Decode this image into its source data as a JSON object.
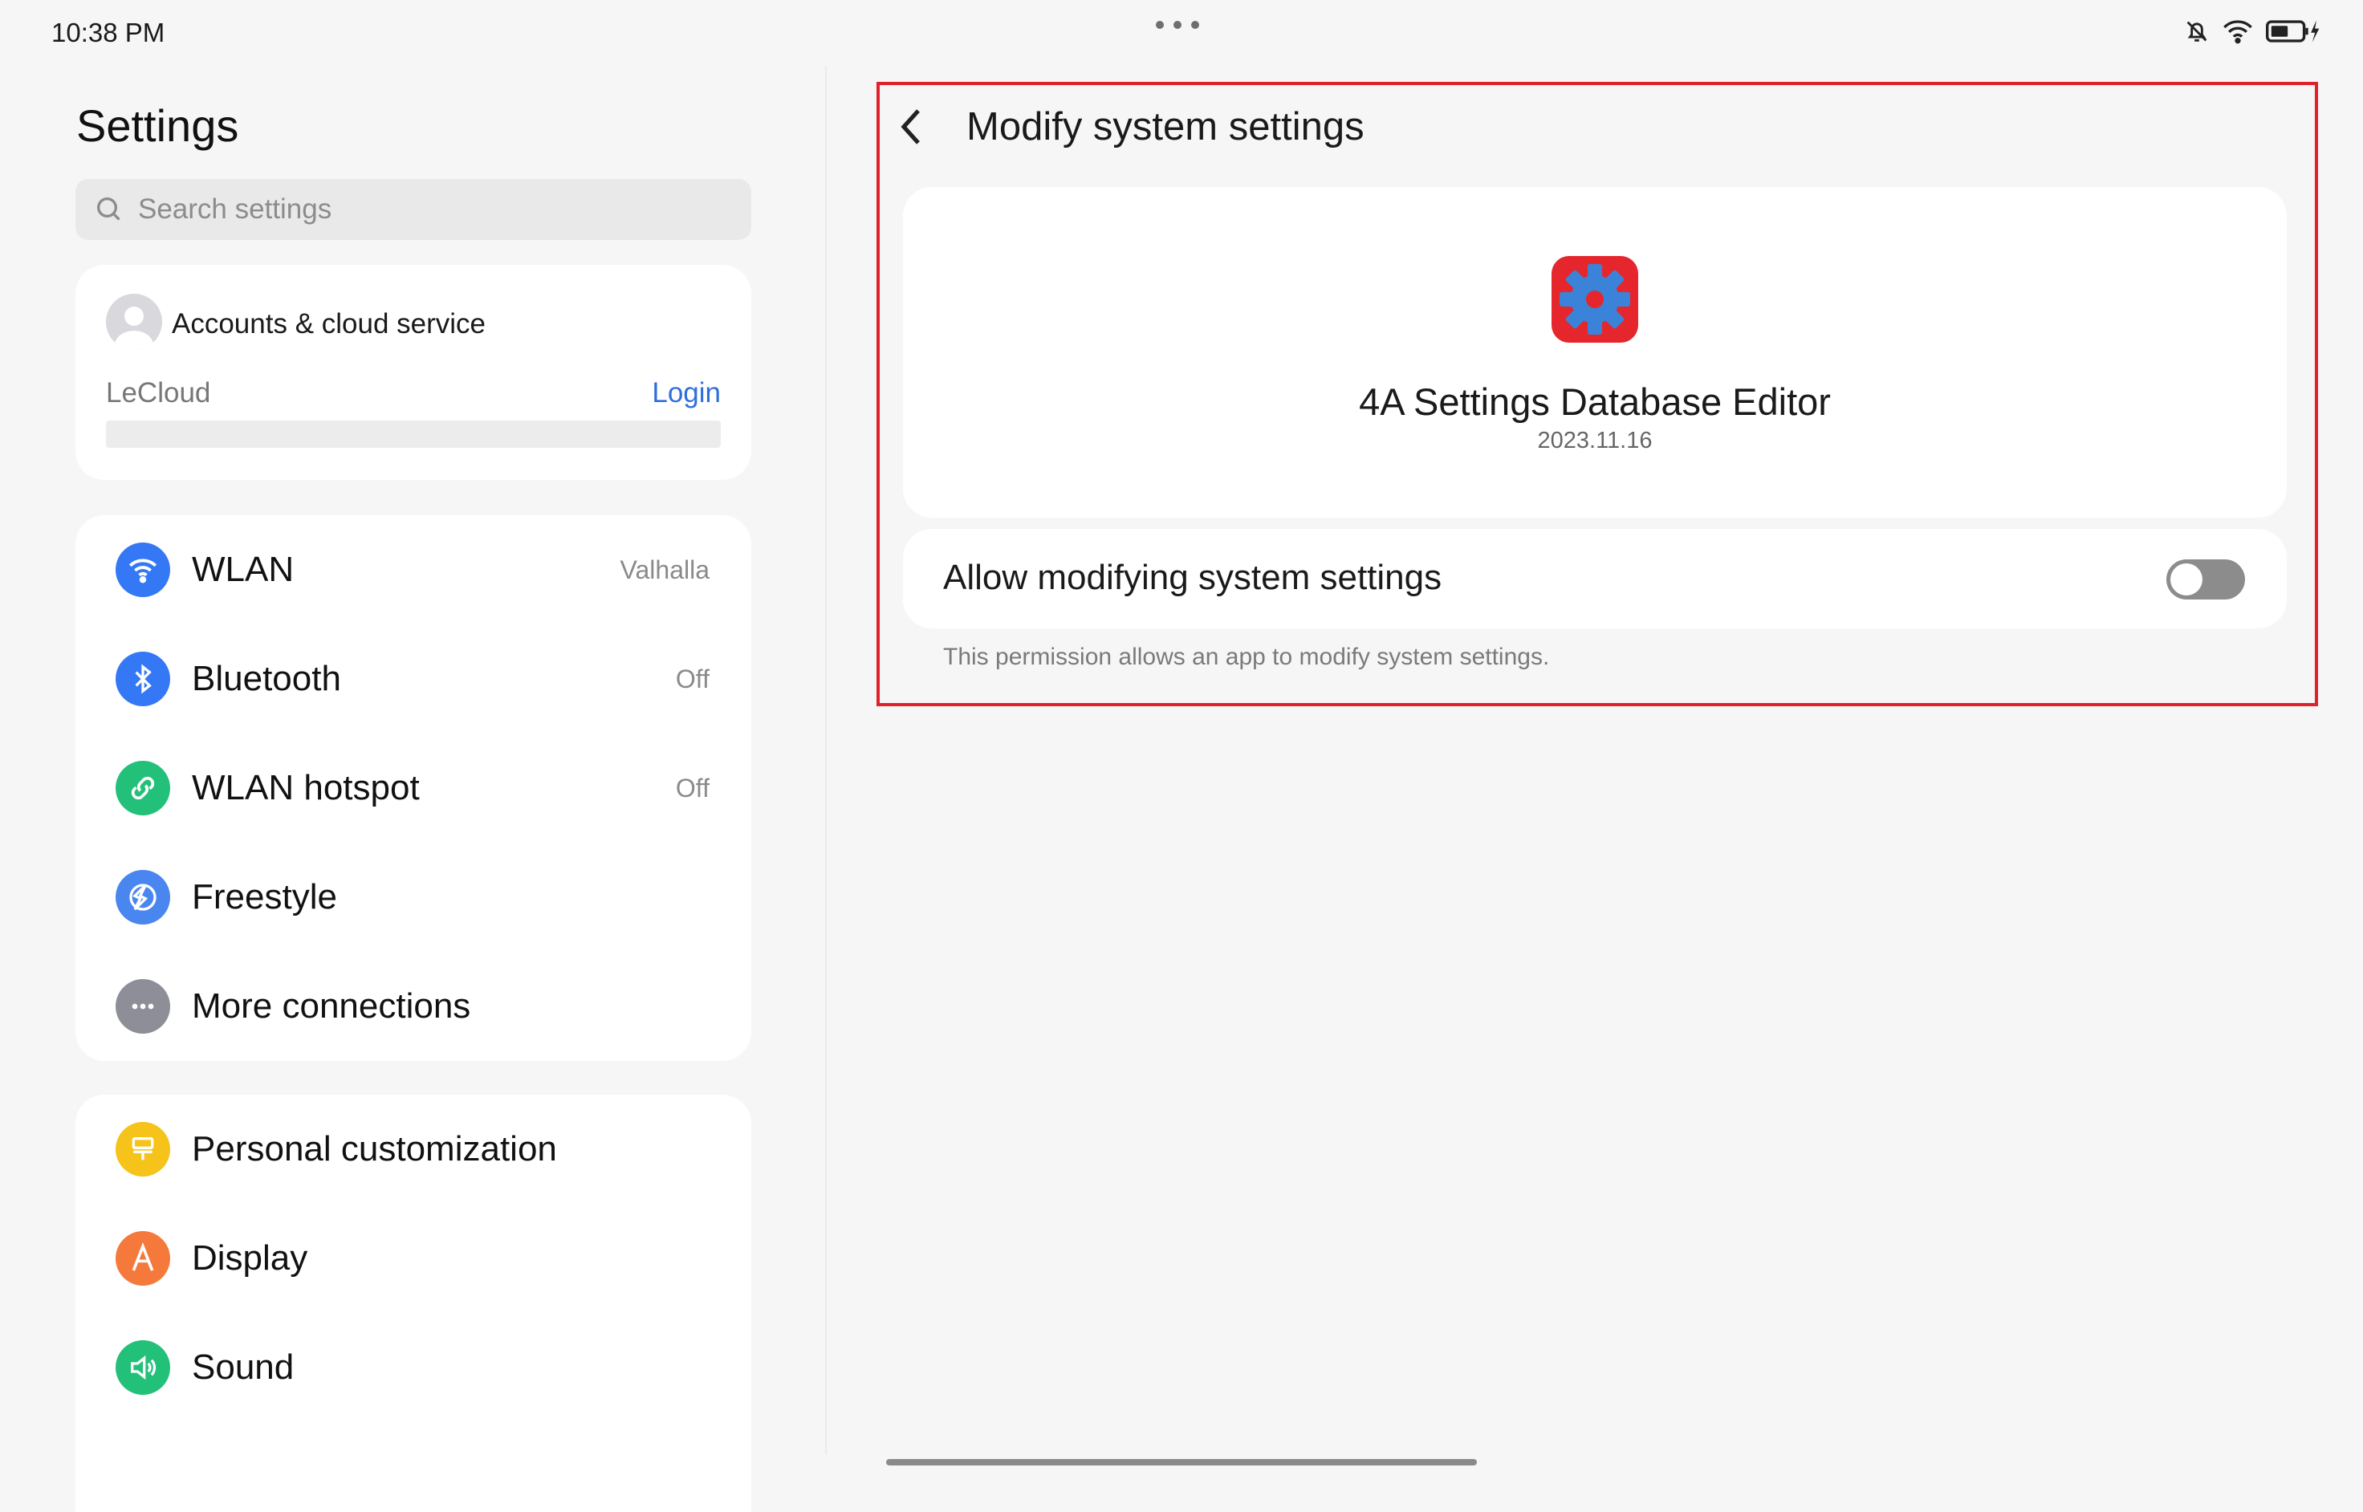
{
  "status_bar": {
    "time": "10:38 PM",
    "icons": [
      "bell-off-icon",
      "wifi-icon",
      "battery-charging-icon"
    ]
  },
  "sidebar": {
    "title": "Settings",
    "search": {
      "placeholder": "Search settings",
      "value": ""
    },
    "account": {
      "title": "Accounts & cloud service",
      "service": "LeCloud",
      "login_label": "Login"
    },
    "connections": [
      {
        "label": "WLAN",
        "value": "Valhalla",
        "icon": "wifi-icon",
        "color": "#3478f6"
      },
      {
        "label": "Bluetooth",
        "value": "Off",
        "icon": "bluetooth-icon",
        "color": "#3478f6"
      },
      {
        "label": "WLAN hotspot",
        "value": "Off",
        "icon": "link-icon",
        "color": "#23c07a"
      },
      {
        "label": "Freestyle",
        "value": "",
        "icon": "freestyle-icon",
        "color": "#4a86f0"
      },
      {
        "label": "More connections",
        "value": "",
        "icon": "more-dots-icon",
        "color": "#8e8e98"
      }
    ],
    "personal": [
      {
        "label": "Personal customization",
        "icon": "paintbrush-icon",
        "color": "#f5c31a"
      },
      {
        "label": "Display",
        "icon": "display-a-icon",
        "color": "#f5793a"
      },
      {
        "label": "Sound",
        "icon": "speaker-icon",
        "color": "#23c07a"
      }
    ]
  },
  "detail": {
    "title": "Modify system settings",
    "app_name": "4A Settings Database Editor",
    "app_version": "2023.11.16",
    "toggle_label": "Allow modifying system settings",
    "toggle_on": false,
    "description": "This permission allows an app to modify system settings."
  },
  "colors": {
    "accent": "#2f6fdc",
    "highlight": "#e0202a"
  }
}
